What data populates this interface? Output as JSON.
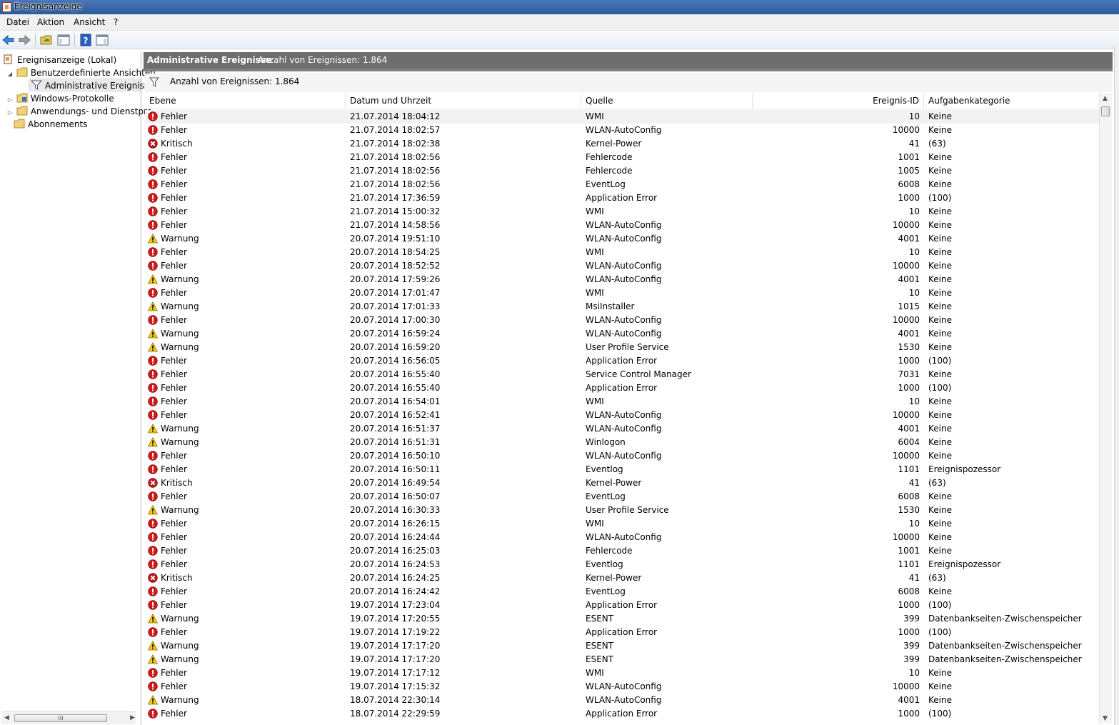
{
  "window": {
    "title": "Ereignisanzeige"
  },
  "menu": [
    "Datei",
    "Aktion",
    "Ansicht",
    "?"
  ],
  "toolbar": {
    "icons": [
      "back-arrow-icon",
      "forward-arrow-icon",
      "open-folder-icon",
      "console-tree-icon",
      "help-icon",
      "action-pane-icon"
    ]
  },
  "tree": {
    "root": "Ereignisanzeige (Lokal)",
    "custom_views": "Benutzerdefinierte Ansichten",
    "admin_events": "Administrative Ereignisse",
    "windows_logs": "Windows-Protokolle",
    "app_service_logs": "Anwendungs- und Dienstpro",
    "subscriptions": "Abonnements",
    "hscroll_grip": "III"
  },
  "main": {
    "title": "Administrative Ereignisse",
    "count": "Anzahl von Ereignissen: 1.864",
    "filter_text": "Anzahl von Ereignissen: 1.864"
  },
  "columns": [
    "Ebene",
    "Datum und Uhrzeit",
    "Quelle",
    "Ereignis-ID",
    "Aufgabenkategorie"
  ],
  "colors": {
    "error": "#d11a1a",
    "critical": "#c0181e",
    "warning": "#f5cd12",
    "header_bar": "#6e6e6e"
  },
  "events": [
    {
      "level": "Fehler",
      "date": "21.07.2014 18:04:12",
      "source": "WMI",
      "id": "10",
      "category": "Keine"
    },
    {
      "level": "Fehler",
      "date": "21.07.2014 18:02:57",
      "source": "WLAN-AutoConfig",
      "id": "10000",
      "category": "Keine"
    },
    {
      "level": "Kritisch",
      "date": "21.07.2014 18:02:38",
      "source": "Kernel-Power",
      "id": "41",
      "category": "(63)"
    },
    {
      "level": "Fehler",
      "date": "21.07.2014 18:02:56",
      "source": "Fehlercode",
      "id": "1001",
      "category": "Keine"
    },
    {
      "level": "Fehler",
      "date": "21.07.2014 18:02:56",
      "source": "Fehlercode",
      "id": "1005",
      "category": "Keine"
    },
    {
      "level": "Fehler",
      "date": "21.07.2014 18:02:56",
      "source": "EventLog",
      "id": "6008",
      "category": "Keine"
    },
    {
      "level": "Fehler",
      "date": "21.07.2014 17:36:59",
      "source": "Application Error",
      "id": "1000",
      "category": "(100)"
    },
    {
      "level": "Fehler",
      "date": "21.07.2014 15:00:32",
      "source": "WMI",
      "id": "10",
      "category": "Keine"
    },
    {
      "level": "Fehler",
      "date": "21.07.2014 14:58:56",
      "source": "WLAN-AutoConfig",
      "id": "10000",
      "category": "Keine"
    },
    {
      "level": "Warnung",
      "date": "20.07.2014 19:51:10",
      "source": "WLAN-AutoConfig",
      "id": "4001",
      "category": "Keine"
    },
    {
      "level": "Fehler",
      "date": "20.07.2014 18:54:25",
      "source": "WMI",
      "id": "10",
      "category": "Keine"
    },
    {
      "level": "Fehler",
      "date": "20.07.2014 18:52:52",
      "source": "WLAN-AutoConfig",
      "id": "10000",
      "category": "Keine"
    },
    {
      "level": "Warnung",
      "date": "20.07.2014 17:59:26",
      "source": "WLAN-AutoConfig",
      "id": "4001",
      "category": "Keine"
    },
    {
      "level": "Fehler",
      "date": "20.07.2014 17:01:47",
      "source": "WMI",
      "id": "10",
      "category": "Keine"
    },
    {
      "level": "Warnung",
      "date": "20.07.2014 17:01:33",
      "source": "MsiInstaller",
      "id": "1015",
      "category": "Keine"
    },
    {
      "level": "Fehler",
      "date": "20.07.2014 17:00:30",
      "source": "WLAN-AutoConfig",
      "id": "10000",
      "category": "Keine"
    },
    {
      "level": "Warnung",
      "date": "20.07.2014 16:59:24",
      "source": "WLAN-AutoConfig",
      "id": "4001",
      "category": "Keine"
    },
    {
      "level": "Warnung",
      "date": "20.07.2014 16:59:20",
      "source": "User Profile Service",
      "id": "1530",
      "category": "Keine"
    },
    {
      "level": "Fehler",
      "date": "20.07.2014 16:56:05",
      "source": "Application Error",
      "id": "1000",
      "category": "(100)"
    },
    {
      "level": "Fehler",
      "date": "20.07.2014 16:55:40",
      "source": "Service Control Manager",
      "id": "7031",
      "category": "Keine"
    },
    {
      "level": "Fehler",
      "date": "20.07.2014 16:55:40",
      "source": "Application Error",
      "id": "1000",
      "category": "(100)"
    },
    {
      "level": "Fehler",
      "date": "20.07.2014 16:54:01",
      "source": "WMI",
      "id": "10",
      "category": "Keine"
    },
    {
      "level": "Fehler",
      "date": "20.07.2014 16:52:41",
      "source": "WLAN-AutoConfig",
      "id": "10000",
      "category": "Keine"
    },
    {
      "level": "Warnung",
      "date": "20.07.2014 16:51:37",
      "source": "WLAN-AutoConfig",
      "id": "4001",
      "category": "Keine"
    },
    {
      "level": "Warnung",
      "date": "20.07.2014 16:51:31",
      "source": "Winlogon",
      "id": "6004",
      "category": "Keine"
    },
    {
      "level": "Fehler",
      "date": "20.07.2014 16:50:10",
      "source": "WLAN-AutoConfig",
      "id": "10000",
      "category": "Keine"
    },
    {
      "level": "Fehler",
      "date": "20.07.2014 16:50:11",
      "source": "Eventlog",
      "id": "1101",
      "category": "Ereignispozessor"
    },
    {
      "level": "Kritisch",
      "date": "20.07.2014 16:49:54",
      "source": "Kernel-Power",
      "id": "41",
      "category": "(63)"
    },
    {
      "level": "Fehler",
      "date": "20.07.2014 16:50:07",
      "source": "EventLog",
      "id": "6008",
      "category": "Keine"
    },
    {
      "level": "Warnung",
      "date": "20.07.2014 16:30:33",
      "source": "User Profile Service",
      "id": "1530",
      "category": "Keine"
    },
    {
      "level": "Fehler",
      "date": "20.07.2014 16:26:15",
      "source": "WMI",
      "id": "10",
      "category": "Keine"
    },
    {
      "level": "Fehler",
      "date": "20.07.2014 16:24:44",
      "source": "WLAN-AutoConfig",
      "id": "10000",
      "category": "Keine"
    },
    {
      "level": "Fehler",
      "date": "20.07.2014 16:25:03",
      "source": "Fehlercode",
      "id": "1001",
      "category": "Keine"
    },
    {
      "level": "Fehler",
      "date": "20.07.2014 16:24:53",
      "source": "Eventlog",
      "id": "1101",
      "category": "Ereignispozessor"
    },
    {
      "level": "Kritisch",
      "date": "20.07.2014 16:24:25",
      "source": "Kernel-Power",
      "id": "41",
      "category": "(63)"
    },
    {
      "level": "Fehler",
      "date": "20.07.2014 16:24:42",
      "source": "EventLog",
      "id": "6008",
      "category": "Keine"
    },
    {
      "level": "Fehler",
      "date": "19.07.2014 17:23:04",
      "source": "Application Error",
      "id": "1000",
      "category": "(100)"
    },
    {
      "level": "Warnung",
      "date": "19.07.2014 17:20:55",
      "source": "ESENT",
      "id": "399",
      "category": "Datenbankseiten-Zwischenspeicher"
    },
    {
      "level": "Fehler",
      "date": "19.07.2014 17:19:22",
      "source": "Application Error",
      "id": "1000",
      "category": "(100)"
    },
    {
      "level": "Warnung",
      "date": "19.07.2014 17:17:20",
      "source": "ESENT",
      "id": "399",
      "category": "Datenbankseiten-Zwischenspeicher"
    },
    {
      "level": "Warnung",
      "date": "19.07.2014 17:17:20",
      "source": "ESENT",
      "id": "399",
      "category": "Datenbankseiten-Zwischenspeicher"
    },
    {
      "level": "Fehler",
      "date": "19.07.2014 17:17:12",
      "source": "WMI",
      "id": "10",
      "category": "Keine"
    },
    {
      "level": "Fehler",
      "date": "19.07.2014 17:15:32",
      "source": "WLAN-AutoConfig",
      "id": "10000",
      "category": "Keine"
    },
    {
      "level": "Warnung",
      "date": "18.07.2014 22:30:14",
      "source": "WLAN-AutoConfig",
      "id": "4001",
      "category": "Keine"
    },
    {
      "level": "Fehler",
      "date": "18.07.2014 22:29:59",
      "source": "Application Error",
      "id": "1000",
      "category": "(100)"
    }
  ]
}
